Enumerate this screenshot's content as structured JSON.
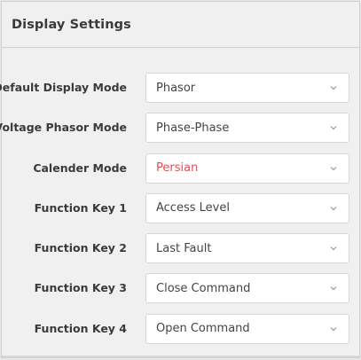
{
  "header": {
    "title": "Display Settings"
  },
  "settings": [
    {
      "label": "Default Display Mode",
      "value": "Phasor",
      "accent": false
    },
    {
      "label": "Voltage Phasor Mode",
      "value": "Phase-Phase",
      "accent": false
    },
    {
      "label": "Calender Mode",
      "value": "Persian",
      "accent": true
    },
    {
      "label": "Function Key 1",
      "value": "Access Level",
      "accent": false
    },
    {
      "label": "Function Key 2",
      "value": "Last Fault",
      "accent": false
    },
    {
      "label": "Function Key 3",
      "value": "Close Command",
      "accent": false
    },
    {
      "label": "Function Key 4",
      "value": "Open Command",
      "accent": false
    }
  ],
  "colors": {
    "accent": "#e05252",
    "text": "#3a3a3a",
    "panel_bg": "#f0f0f0",
    "field_bg": "#ffffff"
  },
  "icons": {
    "dropdown": "chevron-down-icon"
  }
}
